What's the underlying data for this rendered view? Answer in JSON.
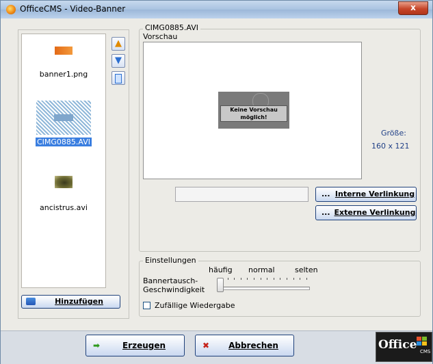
{
  "window": {
    "title": "OfficeCMS - Video-Banner",
    "close_symbol": "x"
  },
  "list": {
    "items": [
      {
        "label": "banner1.png",
        "selected": false
      },
      {
        "label": "CIMG0885.AVI",
        "selected": true
      },
      {
        "label": "ancistrus.avi",
        "selected": false
      }
    ],
    "add_button": "Hinzufügen"
  },
  "side_buttons": {
    "up_icon": "arrow-up-icon",
    "down_icon": "arrow-down-icon",
    "third_icon": "rename-icon"
  },
  "details": {
    "file_title": "CIMG0885.AVI",
    "preview_label": "Vorschau",
    "no_preview_text": "Keine Vorschau möglich!",
    "size_label": "Größe:",
    "size_value": "160 x 121",
    "link_field_value": "",
    "dots_label": "...",
    "internal_link_button": "Interne Verlinkung",
    "external_link_button": "Externe Verlinkung"
  },
  "settings": {
    "title": "Einstellungen",
    "speed_label": "Bannertausch-\nGeschwindigkeit",
    "speed_label_line1": "Bannertausch-",
    "speed_label_line2": "Geschwindigkeit",
    "scale_low": "häufig",
    "scale_mid": "normal",
    "scale_high": "selten",
    "speed_position_fraction": 0.0,
    "random_playback_label": "Zufällige Wiedergabe",
    "random_playback_checked": false
  },
  "footer": {
    "create_button": "Erzeugen",
    "cancel_button": "Abbrechen",
    "logo_text": "Office",
    "logo_sub": "CMS"
  },
  "colors": {
    "selection": "#3a7ee0",
    "link_text": "#1f3f86"
  }
}
